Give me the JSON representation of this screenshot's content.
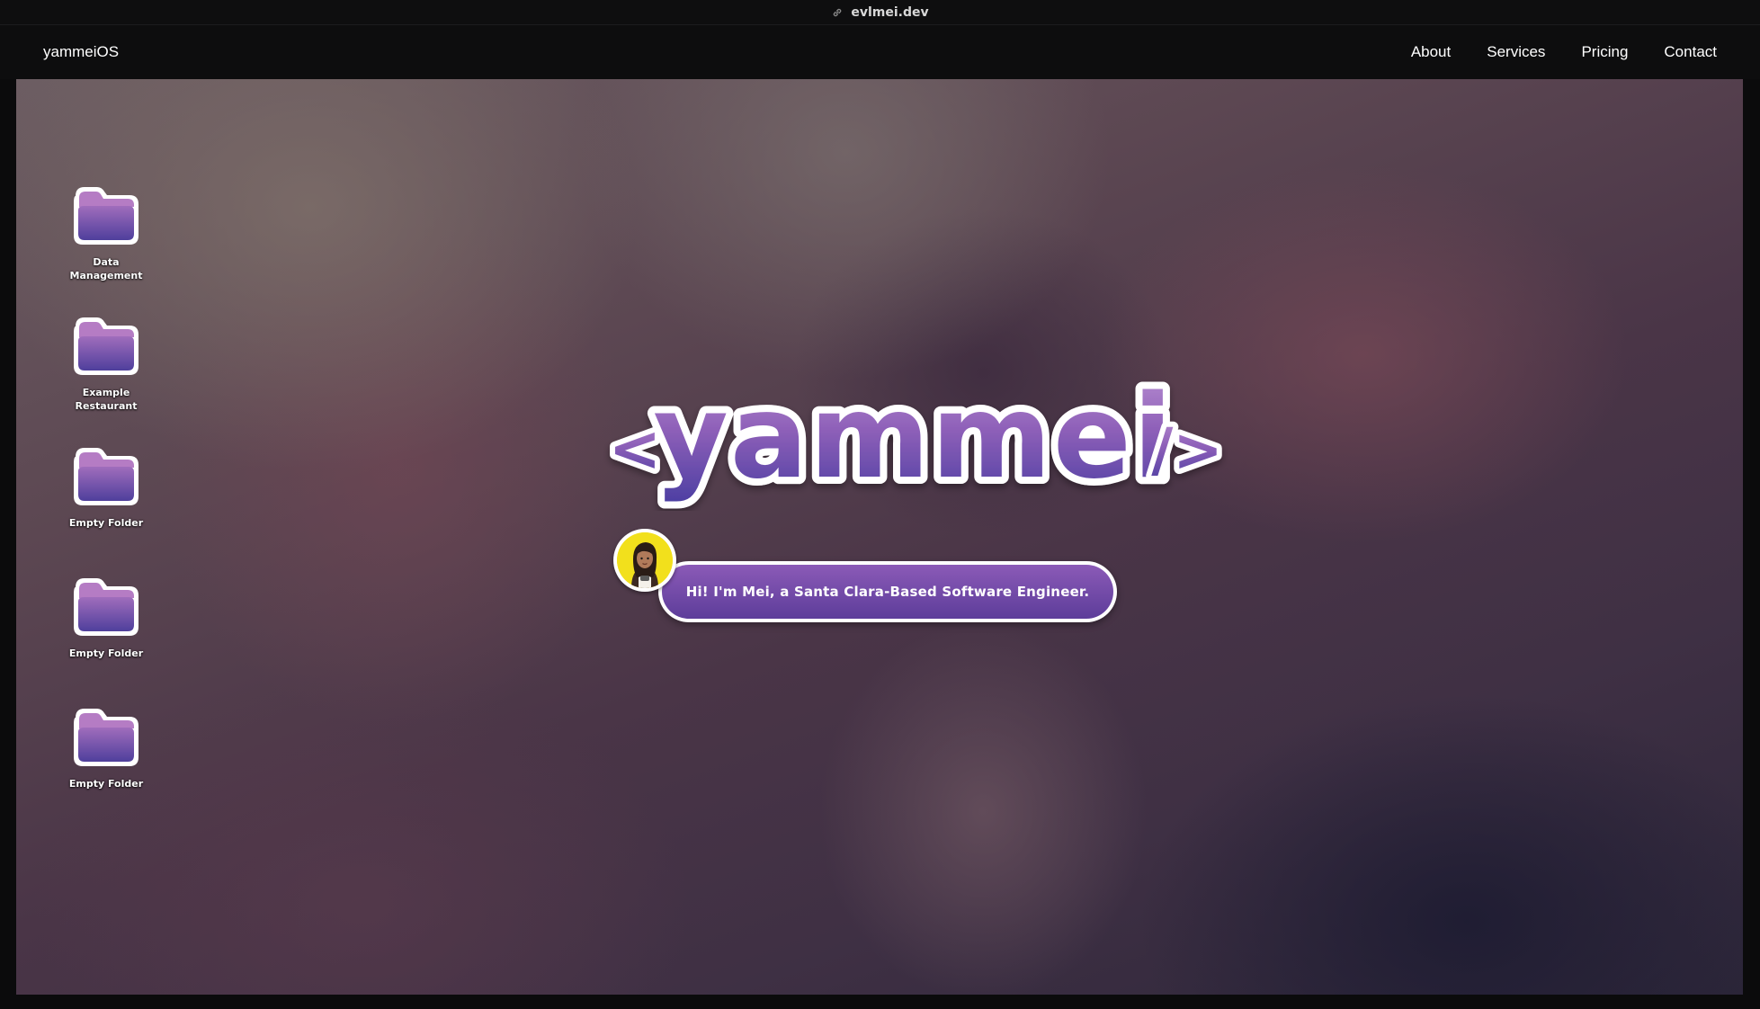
{
  "browser": {
    "url": "evlmei.dev"
  },
  "navbar": {
    "brand": "yammeiOS",
    "links": [
      {
        "label": "About"
      },
      {
        "label": "Services"
      },
      {
        "label": "Pricing"
      },
      {
        "label": "Contact"
      }
    ]
  },
  "desktop": {
    "folders": [
      {
        "line1": "Data",
        "line2": "Management"
      },
      {
        "line1": "Example",
        "line2": "Restaurant"
      },
      {
        "line1": "Empty Folder",
        "line2": ""
      },
      {
        "line1": "Empty Folder",
        "line2": ""
      },
      {
        "line1": "Empty Folder",
        "line2": ""
      }
    ],
    "logo": {
      "open_tag": "<",
      "name": "yammei",
      "close_tag": "/>"
    },
    "greeting": "Hi! I'm Mei, a Santa Clara-Based Software Engineer."
  },
  "colors": {
    "folder_top": "#a06dbc",
    "folder_bottom": "#4f3f9c",
    "bubble_top": "#8b5ab7",
    "bubble_bottom": "#5d3d9a",
    "avatar_bg": "#f2e01c"
  },
  "icons": {
    "url_prefix": "link-icon",
    "folder": "folder-icon",
    "avatar": "avatar-icon"
  }
}
